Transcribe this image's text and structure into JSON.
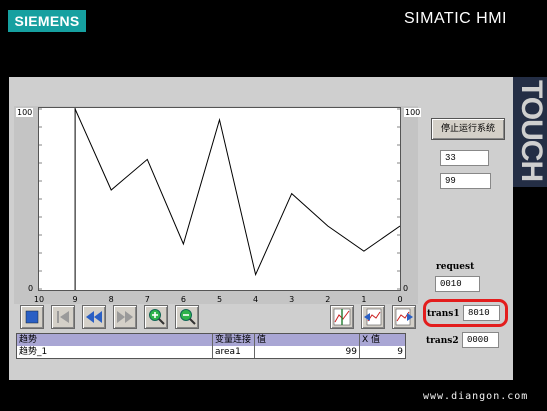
{
  "header": {
    "brand": "SIEMENS",
    "title": "SIMATIC HMI"
  },
  "touch_label": "TOUCH",
  "trend": {
    "y_axis": {
      "left": {
        "top": "100",
        "bottom": "0"
      },
      "right": {
        "top": "100",
        "bottom": "0"
      }
    },
    "x_ticks": [
      "10",
      "9",
      "8",
      "7",
      "6",
      "5",
      "4",
      "3",
      "2",
      "1",
      "0"
    ],
    "cursor_x": 9,
    "series": [
      {
        "x": 9,
        "y": 100
      },
      {
        "x": 8,
        "y": 55
      },
      {
        "x": 7,
        "y": 72
      },
      {
        "x": 6,
        "y": 25
      },
      {
        "x": 5,
        "y": 94
      },
      {
        "x": 4,
        "y": 8
      },
      {
        "x": 3,
        "y": 53
      },
      {
        "x": 2,
        "y": 35
      },
      {
        "x": 1,
        "y": 21
      },
      {
        "x": 0,
        "y": 35
      }
    ],
    "toolbar": [
      {
        "name": "stop-icon-button"
      },
      {
        "name": "goto-first-icon-button"
      },
      {
        "name": "rewind-icon-button"
      },
      {
        "name": "fast-forward-icon-button"
      },
      {
        "name": "zoom-in-icon-button"
      },
      {
        "name": "zoom-out-icon-button"
      },
      {
        "name": "trend-ruler-icon-button"
      },
      {
        "name": "trend-back-icon-button"
      },
      {
        "name": "trend-forward-icon-button"
      }
    ],
    "table": {
      "headers": [
        "趋势",
        "变量连接",
        "值",
        "X 值"
      ],
      "rows": [
        [
          "趋势_1",
          "area1",
          "99",
          "9"
        ]
      ]
    }
  },
  "controls": {
    "stop_button": "停止运行系统",
    "field1": "33",
    "field2": "99",
    "request_label": "request",
    "request_value": "0010",
    "trans1_label": "trans1",
    "trans1_value": "8010",
    "trans2_label": "trans2",
    "trans2_value": "0000"
  },
  "colors": {
    "brand": "#16a0a0",
    "highlight_ring": "#e31d1d",
    "table_header": "#a9a6d4"
  },
  "watermark": "www.diangon.com"
}
